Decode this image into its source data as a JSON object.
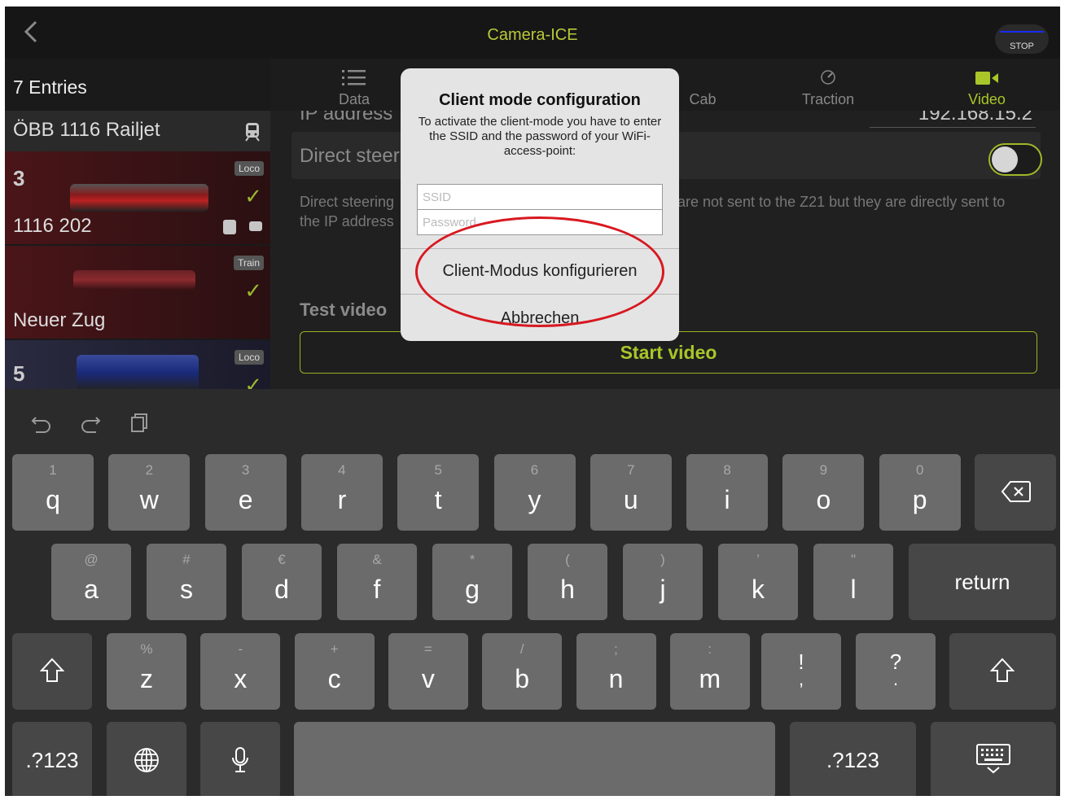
{
  "app": {
    "title": "Camera-ICE",
    "stop_label": "STOP"
  },
  "sidebar": {
    "entries_label": "7 Entries",
    "items": [
      {
        "name": "ÖBB 1116 Railjet"
      },
      {
        "number": "3",
        "badge": "Loco",
        "name": "1116 202"
      },
      {
        "badge": "Train",
        "name": "Neuer Zug"
      },
      {
        "number": "5",
        "badge": "Loco"
      }
    ]
  },
  "tabs": [
    {
      "label": "Data",
      "icon": "list-icon"
    },
    {
      "label": "Cab",
      "icon": "cab-icon"
    },
    {
      "label": "Traction",
      "icon": "gauge-icon"
    },
    {
      "label": "Video",
      "icon": "video-camera-icon",
      "active": true
    }
  ],
  "content": {
    "ip_label": "IP address",
    "ip_value": "192.168.15.2",
    "direct_steering_label": "Direct steering",
    "direct_steering_desc": "Direct steering ... are not sent to the Z21 but they are directly sent to the IP address",
    "desc_left_1": "Direct steering",
    "desc_left_2": "the IP address",
    "desc_right": "are not sent to the Z21 but they are directly sent to",
    "test_video_label": "Test video",
    "start_video_label": "Start video"
  },
  "dialog": {
    "title": "Client mode configuration",
    "message": "To activate the client-mode you have to enter the SSID and the password of your WiFi-access-point:",
    "ssid_placeholder": "SSID",
    "password_placeholder": "Password",
    "confirm_label": "Client-Modus konfigurieren",
    "cancel_label": "Abbrechen",
    "highlight_color": "#d81820"
  },
  "keyboard": {
    "row1": [
      {
        "main": "q",
        "sub": "1"
      },
      {
        "main": "w",
        "sub": "2"
      },
      {
        "main": "e",
        "sub": "3"
      },
      {
        "main": "r",
        "sub": "4"
      },
      {
        "main": "t",
        "sub": "5"
      },
      {
        "main": "y",
        "sub": "6"
      },
      {
        "main": "u",
        "sub": "7"
      },
      {
        "main": "i",
        "sub": "8"
      },
      {
        "main": "o",
        "sub": "9"
      },
      {
        "main": "p",
        "sub": "0"
      }
    ],
    "row2": [
      {
        "main": "a",
        "sub": "@"
      },
      {
        "main": "s",
        "sub": "#"
      },
      {
        "main": "d",
        "sub": "€"
      },
      {
        "main": "f",
        "sub": "&"
      },
      {
        "main": "g",
        "sub": "*"
      },
      {
        "main": "h",
        "sub": "("
      },
      {
        "main": "j",
        "sub": ")"
      },
      {
        "main": "k",
        "sub": "’"
      },
      {
        "main": "l",
        "sub": "\""
      }
    ],
    "row3": [
      {
        "main": "z",
        "sub": "%"
      },
      {
        "main": "x",
        "sub": "-"
      },
      {
        "main": "c",
        "sub": "+"
      },
      {
        "main": "v",
        "sub": "="
      },
      {
        "main": "b",
        "sub": "/"
      },
      {
        "main": "n",
        "sub": ";"
      },
      {
        "main": "m",
        "sub": ":"
      }
    ],
    "punct1": {
      "top": "!",
      "bottom": ","
    },
    "punct2": {
      "top": "?",
      "bottom": "."
    },
    "return_label": "return",
    "numbers_label": ".?123"
  },
  "colors": {
    "accent": "#a8c62a",
    "background": "#000000"
  }
}
